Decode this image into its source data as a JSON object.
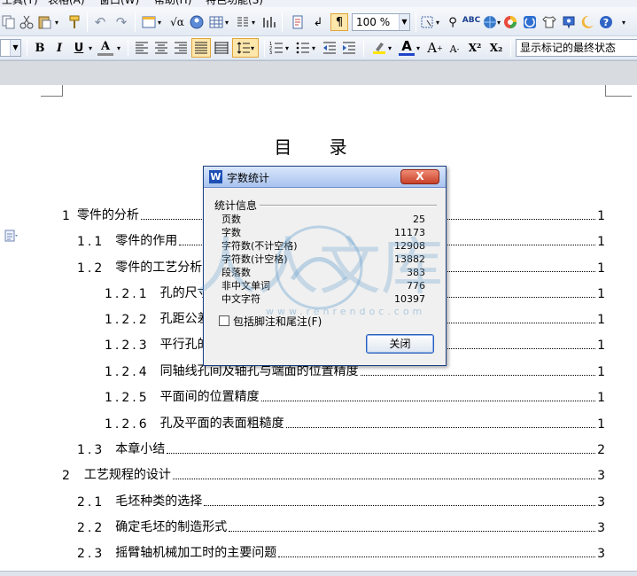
{
  "menu": {
    "items": [
      "工具(T)",
      "表格(A)",
      "窗口(W)",
      "帮助(H)",
      "特色功能(S)"
    ]
  },
  "standard_toolbar": {
    "zoom": "100 %",
    "icons": [
      "copy-icon",
      "cut-icon",
      "paste-icon",
      "format-painter-icon",
      "undo-icon",
      "redo-icon",
      "insert-table-icon",
      "formula-icon",
      "text-box-icon",
      "table-icon",
      "columns-icon",
      "chart-icon",
      "page-icon",
      "insert-icon",
      "show-hide-icon",
      "zoom-icon",
      "select-icon",
      "find-icon",
      "spell-check-icon",
      "globe-icon",
      "colorful-ball-icon",
      "panel-icon",
      "shirt-icon",
      "mic-icon",
      "moon-icon",
      "help-icon"
    ]
  },
  "format_toolbar": {
    "bold": "B",
    "italic": "I",
    "underline": "U",
    "char_shading": "A",
    "font_color": "A",
    "grow_font": "A",
    "shrink_font": "A",
    "superscript": "X²",
    "subscript": "X₂",
    "track_changes_mode": "显示标记的最终状态"
  },
  "toc": {
    "title": "目  录",
    "entries": [
      {
        "num": "1",
        "text": "零件的分析",
        "page": "1"
      },
      {
        "num": "1.1",
        "text": "零件的作用",
        "page": "1"
      },
      {
        "num": "1.2",
        "text": "零件的工艺分析",
        "page": "1"
      },
      {
        "num": "1.2.1",
        "text": "孔的尺寸精度",
        "page": "1"
      },
      {
        "num": "1.2.2",
        "text": "孔距公差",
        "page": "1"
      },
      {
        "num": "1.2.3",
        "text": "平行孔的位置精度",
        "page": "1"
      },
      {
        "num": "1.2.4",
        "text": "同轴线孔间及轴孔与端面的位置精度",
        "page": "1"
      },
      {
        "num": "1.2.5",
        "text": "平面间的位置精度",
        "page": "1"
      },
      {
        "num": "1.2.6",
        "text": "孔及平面的表面粗糙度",
        "page": "1"
      },
      {
        "num": "1.3",
        "text": "本章小结",
        "page": "2"
      },
      {
        "num": "2",
        "text": "工艺规程的设计",
        "page": "3"
      },
      {
        "num": "2.1",
        "text": "毛坯种类的选择",
        "page": "3"
      },
      {
        "num": "2.2",
        "text": "确定毛坯的制造形式",
        "page": "3"
      },
      {
        "num": "2.3",
        "text": "摇臂轴机械加工时的主要问题",
        "page": "3"
      }
    ]
  },
  "dialog": {
    "title": "字数统计",
    "logo": "W",
    "group_label": "统计信息",
    "stats": [
      {
        "label": "页数",
        "value": "25"
      },
      {
        "label": "字数",
        "value": "11173"
      },
      {
        "label": "字符数(不计空格)",
        "value": "12908"
      },
      {
        "label": "字符数(计空格)",
        "value": "13882"
      },
      {
        "label": "段落数",
        "value": "383"
      },
      {
        "label": "非中文单词",
        "value": "776"
      },
      {
        "label": "中文字符",
        "value": "10397"
      }
    ],
    "checkbox_label": "包括脚注和尾注(F)",
    "checkbox_checked": false,
    "close_button": "关闭",
    "close_x": "X"
  },
  "watermark": {
    "text": "人人文库",
    "url": "www.renrendoc.com"
  }
}
